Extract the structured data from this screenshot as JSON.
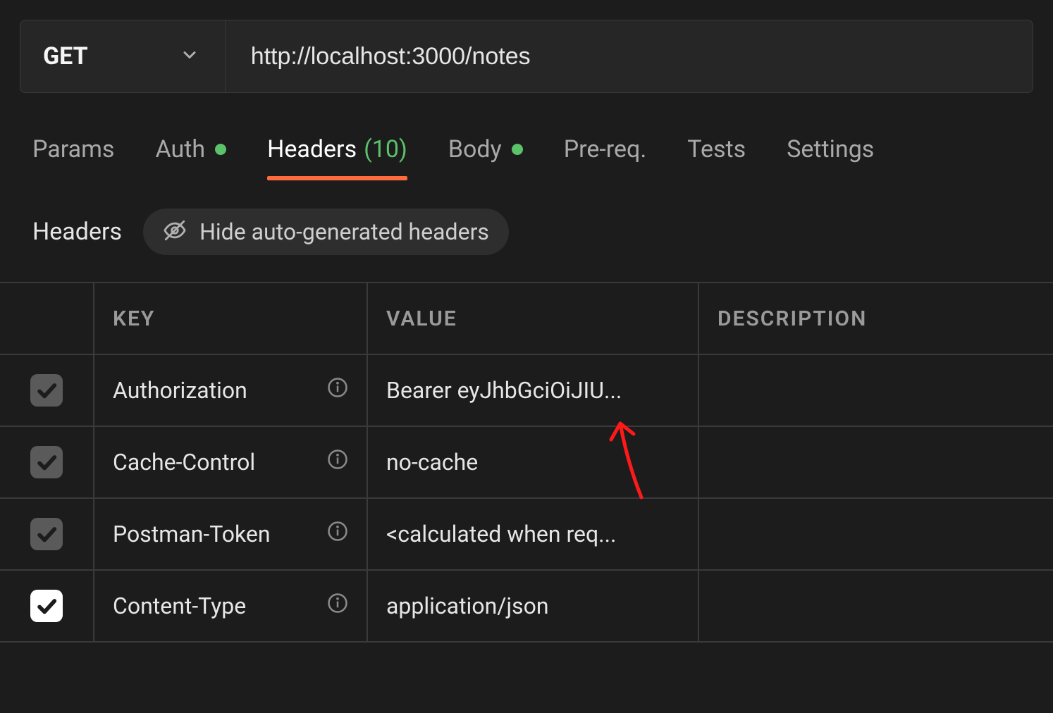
{
  "request": {
    "method": "GET",
    "url": "http://localhost:3000/notes"
  },
  "tabs": {
    "params": "Params",
    "auth": "Auth",
    "headers": "Headers",
    "headers_count": "(10)",
    "body": "Body",
    "prereq": "Pre-req.",
    "tests": "Tests",
    "settings": "Settings"
  },
  "headers_section": {
    "label": "Headers",
    "hide_label": "Hide auto-generated headers",
    "columns": {
      "key": "KEY",
      "value": "VALUE",
      "description": "DESCRIPTION"
    },
    "rows": [
      {
        "enabled": true,
        "auto": true,
        "key": "Authorization",
        "value": "Bearer eyJhbGciOiJIU...",
        "description": ""
      },
      {
        "enabled": true,
        "auto": true,
        "key": "Cache-Control",
        "value": "no-cache",
        "description": ""
      },
      {
        "enabled": true,
        "auto": true,
        "key": "Postman-Token",
        "value": "<calculated when req...",
        "description": ""
      },
      {
        "enabled": true,
        "auto": false,
        "key": "Content-Type",
        "value": "application/json",
        "description": ""
      }
    ]
  }
}
